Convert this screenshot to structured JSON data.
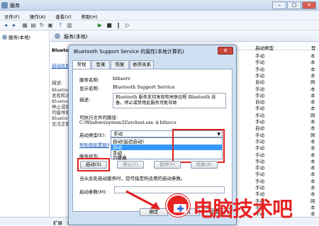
{
  "window": {
    "title": "服务",
    "min": "–",
    "max": "□",
    "close": "✕"
  },
  "menu": [
    "文件(F)",
    "操作(A)",
    "查看(V)",
    "帮助(H)"
  ],
  "tree": {
    "root": "服务(本地)"
  },
  "header": {
    "title": "服务(本地)"
  },
  "left_pane": {
    "service_title": "Bluetooth Support Service",
    "link": "启动此服务",
    "desc_label": "描述:",
    "desc_lines": [
      "Bluetooth 服务支持",
      "发现和关联远程",
      "Bluetooth 设备。",
      "停止或禁用此服务",
      "可能导致已安装的",
      "Bluetooth 设备",
      "无法正确操作。"
    ]
  },
  "list": {
    "col_startup": "启动类型",
    "col_login": "登",
    "startup_types": [
      "手动",
      "手动",
      "手动",
      "手动",
      "自动",
      "手动",
      "手动",
      "自动",
      "手动",
      "手动",
      "手动",
      "自动",
      "手动",
      "手动",
      "手动",
      "手动",
      "手动",
      "手动",
      "手动",
      "手动",
      "手动",
      "手动",
      "手动",
      "手动",
      "手动"
    ],
    "login_types": [
      "本地系统",
      "本地服务",
      "本地系统",
      "本地系统",
      "网络服务",
      "本地系统",
      "本地服务",
      "本地系统",
      "本地服务",
      "网络服务",
      "本地系统",
      "本地系统",
      "网络服务",
      "本地系统",
      "本地服务",
      "本地系统",
      "本地服务",
      "本地系统",
      "本地服务",
      "本地系统",
      "本地服务",
      "本地系统",
      "网络服务",
      "本地系统",
      "本地服务"
    ]
  },
  "bottom_tabs": [
    "扩展",
    "标准"
  ],
  "dialog": {
    "title": "Bluetooth Support Service 的属性(本地计算机)",
    "close": "✕",
    "tabs": [
      "常规",
      "登录",
      "恢复",
      "依存关系"
    ],
    "service_name_label": "服务名称:",
    "service_name": "bthserv",
    "display_name_label": "显示名称:",
    "display_name": "Bluetooth Support Service",
    "desc_label": "描述:",
    "description": "Bluetooth 服务支持发现和关联远程 Bluetooth 设备。停止或禁用此服务可能导致",
    "path_label": "可执行文件的路径:",
    "path": "C:\\Windows\\system32\\svchost.exe -k bthsvcs",
    "startup_label": "启动类型(E):",
    "startup_value": "手动",
    "startup_options": [
      "自动(延迟启动)",
      "自动",
      "手动",
      "已禁用"
    ],
    "help_link": "帮助我配置服务启动选项。",
    "status_label": "服务状态:",
    "status_value": "已停止",
    "buttons": {
      "start": "启动(S)",
      "stop": "停止(T)",
      "pause": "暂停(P)",
      "resume": "恢复(R)"
    },
    "hint": "当从此处启动服务时，您可指定所适用的启动参数。",
    "params_label": "启动参数(M):",
    "ok": "确定",
    "cancel": "取消",
    "apply": "应用(A)"
  },
  "watermark": {
    "text": "电脑技术吧"
  },
  "colors": {
    "highlight": "#e02020",
    "watermark": "#e62323",
    "selection": "#3399ff"
  }
}
